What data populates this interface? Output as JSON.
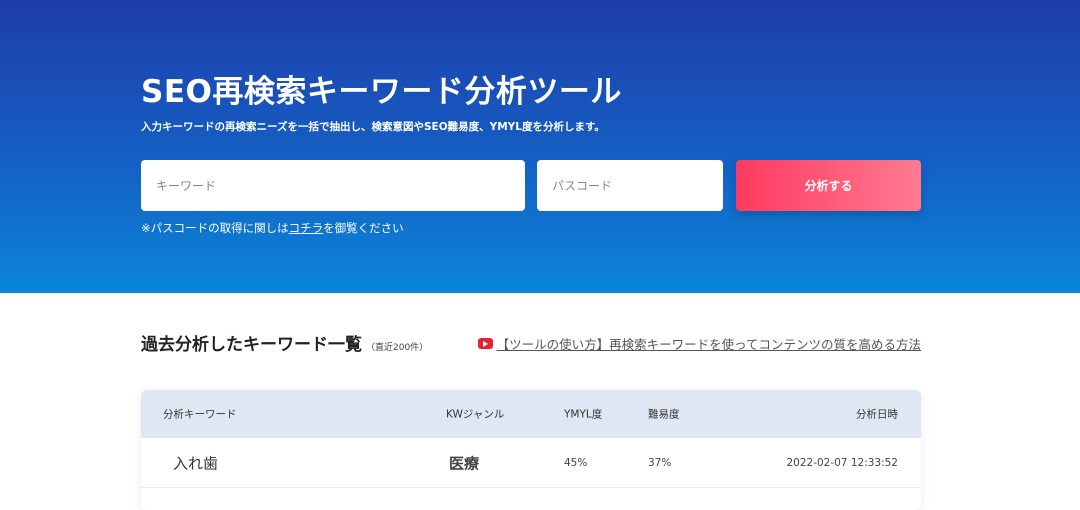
{
  "hero": {
    "title": "SEO再検索キーワード分析ツール",
    "subtitle": "入力キーワードの再検索ニーズを一括で抽出し、検索意図やSEO難易度、YMYL度を分析します。",
    "keyword_placeholder": "キーワード",
    "passcode_placeholder": "パスコード",
    "submit_label": "分析する",
    "note_prefix": "※パスコードの取得に関しは",
    "note_link": "コチラ",
    "note_suffix": "を御覧ください"
  },
  "history": {
    "title": "過去分析したキーワード一覧",
    "title_sub": "（直近200件）",
    "video_link": "【ツールの使い方】再検索キーワードを使ってコンテンツの質を高める方法",
    "columns": [
      "分析キーワード",
      "KWジャンル",
      "YMYL度",
      "難易度",
      "分析日時"
    ],
    "rows": [
      {
        "keyword": "入れ歯",
        "genre": "医療",
        "ymyl": "45%",
        "difficulty": "37%",
        "date": "2022-02-07 12:33:52"
      }
    ]
  },
  "colors": {
    "hero_top": "#1e3da9",
    "hero_bottom": "#0a86d8",
    "button_start": "#ff3a60",
    "button_end": "#ff7a92",
    "table_header_bg": "#dfe7f2",
    "youtube_red": "#e32232"
  },
  "icons": {
    "video": "youtube-play-icon"
  }
}
